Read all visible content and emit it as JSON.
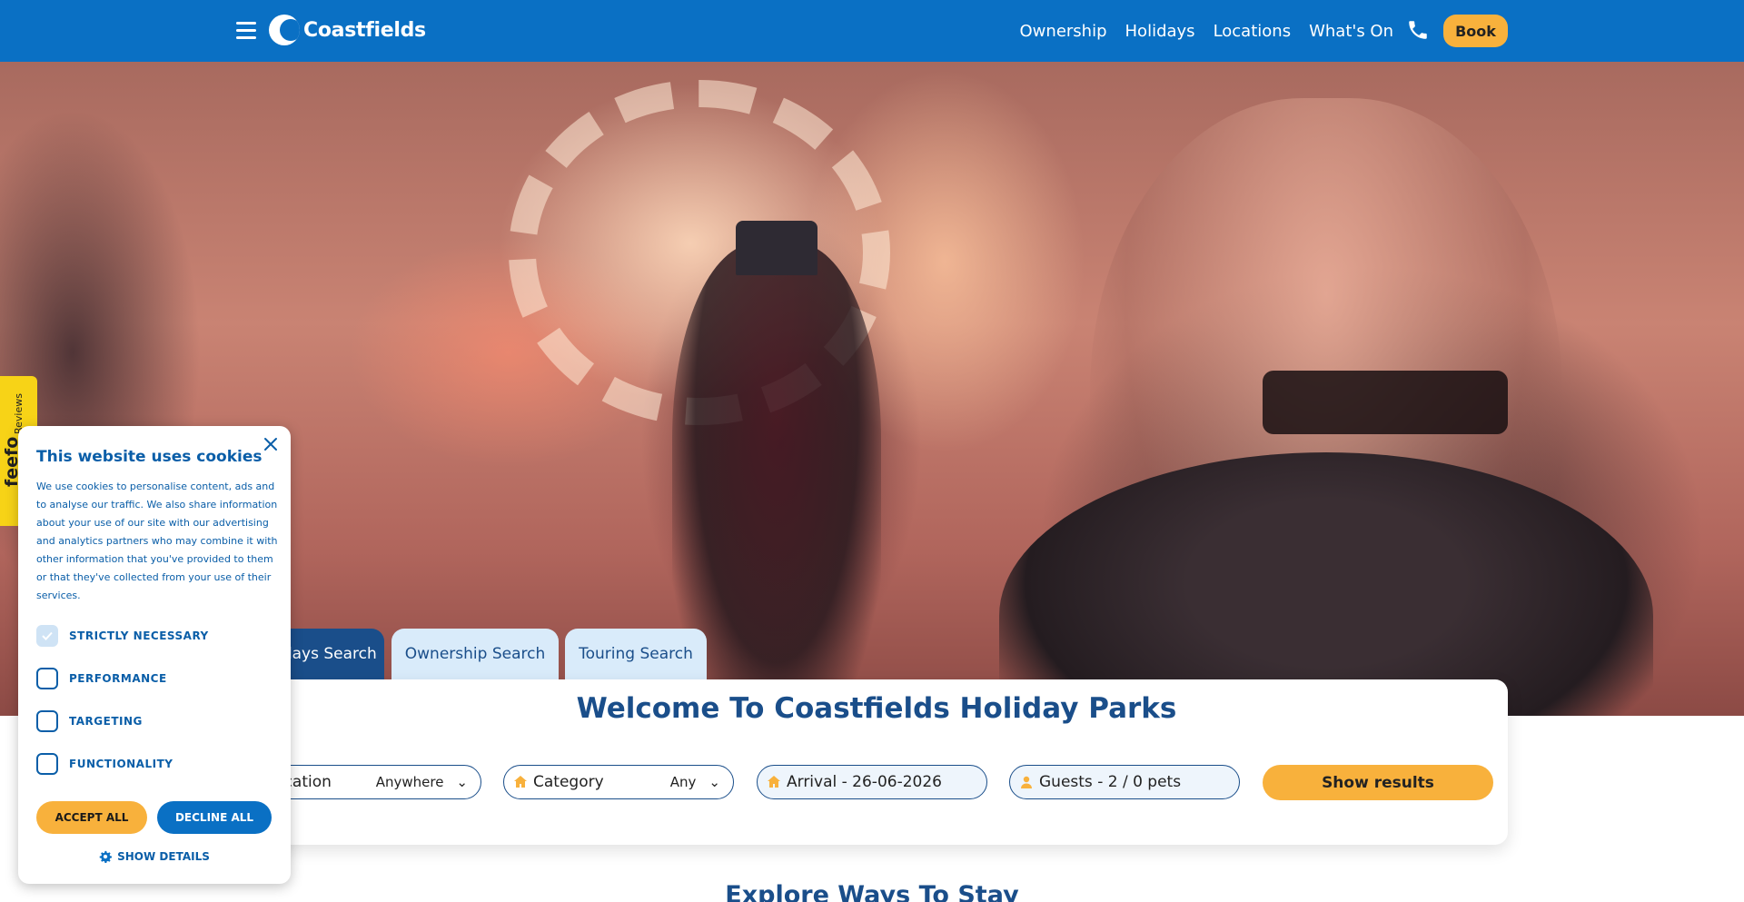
{
  "header": {
    "brand": "Coastfields",
    "nav": [
      "Ownership",
      "Holidays",
      "Locations",
      "What's On"
    ],
    "book_label": "Book",
    "colors": {
      "bar": "#0a70c4",
      "accent": "#f8b13c"
    }
  },
  "search": {
    "tabs": [
      "Holidays Search",
      "Ownership Search",
      "Touring Search"
    ],
    "active_tab": "Holidays Search",
    "title": "Welcome To Coastfields Holiday Parks",
    "location_label": "Location",
    "location_value": "Anywhere",
    "category_label": "Category",
    "category_value": "Any",
    "arrival": "Arrival - 26-06-2026",
    "guests": "Guests - 2 / 0 pets",
    "submit_label": "Show results"
  },
  "explore_heading": "Explore Ways To Stay",
  "feefo": {
    "brand": "feefo",
    "label": "Reviews"
  },
  "cookie": {
    "title": "This website uses cookies",
    "body": "We use cookies to personalise content, ads and to analyse our traffic. We also share information about your use of our site with our advertising and analytics partners who may combine it with other information that you've provided to them or that they've collected from your use of their services.",
    "options": [
      {
        "label": "STRICTLY NECESSARY",
        "checked": true
      },
      {
        "label": "PERFORMANCE",
        "checked": false
      },
      {
        "label": "TARGETING",
        "checked": false
      },
      {
        "label": "FUNCTIONALITY",
        "checked": false
      }
    ],
    "accept_label": "ACCEPT ALL",
    "decline_label": "DECLINE ALL",
    "details_label": "SHOW DETAILS"
  }
}
